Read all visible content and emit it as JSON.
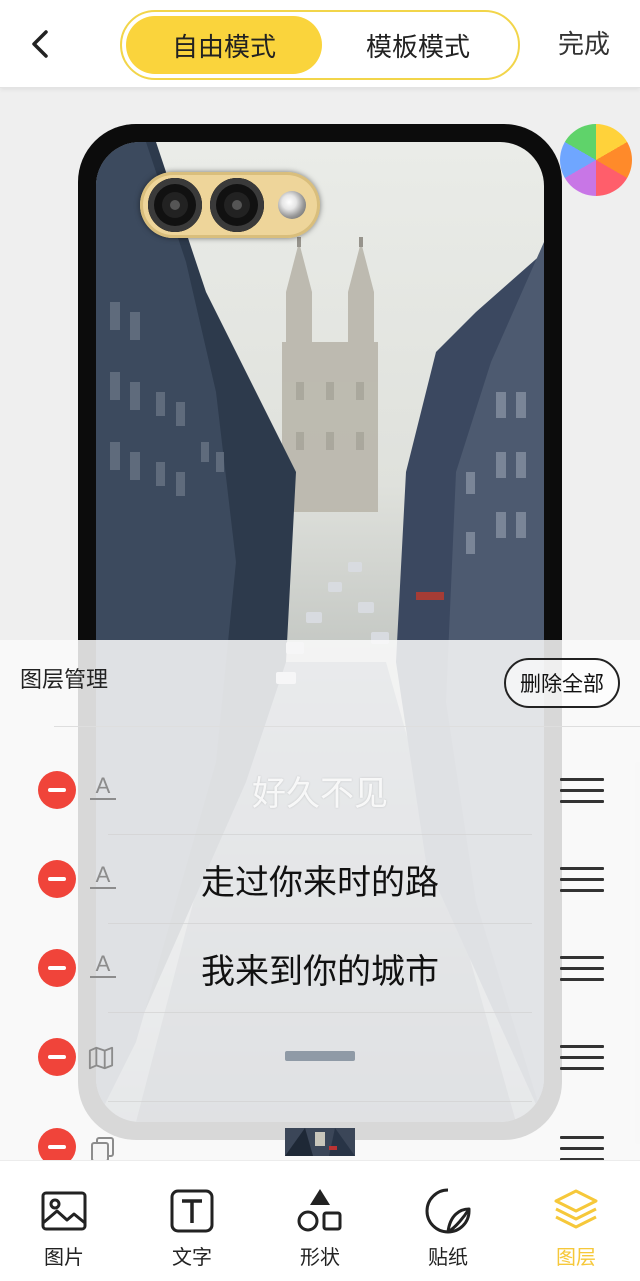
{
  "header": {
    "tabs": [
      {
        "label": "自由模式",
        "active": true
      },
      {
        "label": "模板模式",
        "active": false
      }
    ],
    "done_label": "完成"
  },
  "panel": {
    "title": "图层管理",
    "delete_all_label": "删除全部",
    "layers": [
      {
        "type": "text",
        "type_icon": "A",
        "content": "好久不见",
        "faded": true
      },
      {
        "type": "text",
        "type_icon": "A",
        "content": "走过你来时的路",
        "faded": false
      },
      {
        "type": "text",
        "type_icon": "A",
        "content": "我来到你的城市",
        "faded": false
      },
      {
        "type": "sticker",
        "type_icon": "map-icon",
        "content": ""
      },
      {
        "type": "image",
        "type_icon": "copy-icon",
        "content": ""
      }
    ]
  },
  "canvas": {
    "overlay_text_1": "我来到你的城市",
    "overlay_text_2": "走过你来时的路"
  },
  "bottom_nav": [
    {
      "label": "图片",
      "icon": "image-icon"
    },
    {
      "label": "文字",
      "icon": "text-icon"
    },
    {
      "label": "形状",
      "icon": "shapes-icon"
    },
    {
      "label": "贴纸",
      "icon": "sticker-icon"
    },
    {
      "label": "图层",
      "icon": "layers-icon",
      "active": true
    }
  ],
  "colors": {
    "accent": "#fad43c",
    "danger": "#f0443a",
    "active_nav": "#f6c83a"
  }
}
